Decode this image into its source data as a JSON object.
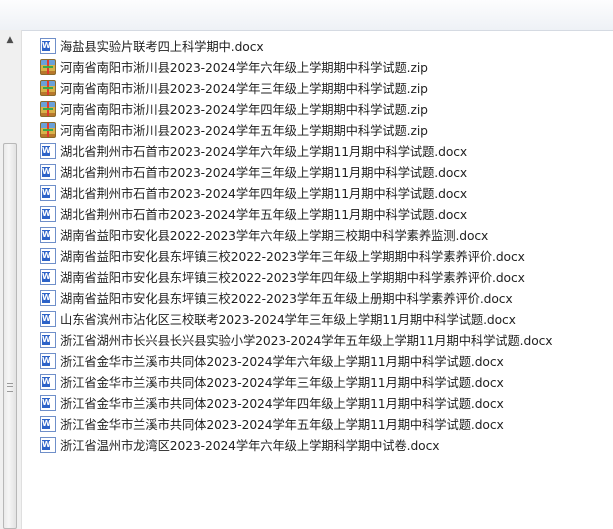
{
  "files": [
    {
      "name": "海盐县实验片联考四上科学期中.docx",
      "icon": "word-doc-icon"
    },
    {
      "name": "河南省南阳市淅川县2023-2024学年六年级上学期期中科学试题.zip",
      "icon": "zip-archive-icon"
    },
    {
      "name": "河南省南阳市淅川县2023-2024学年三年级上学期期中科学试题.zip",
      "icon": "zip-archive-icon"
    },
    {
      "name": "河南省南阳市淅川县2023-2024学年四年级上学期期中科学试题.zip",
      "icon": "zip-archive-icon"
    },
    {
      "name": "河南省南阳市淅川县2023-2024学年五年级上学期期中科学试题.zip",
      "icon": "zip-archive-icon"
    },
    {
      "name": "湖北省荆州市石首市2023-2024学年六年级上学期11月期中科学试题.docx",
      "icon": "word-doc-icon"
    },
    {
      "name": "湖北省荆州市石首市2023-2024学年三年级上学期11月期中科学试题.docx",
      "icon": "word-doc-icon"
    },
    {
      "name": "湖北省荆州市石首市2023-2024学年四年级上学期11月期中科学试题.docx",
      "icon": "word-doc-icon"
    },
    {
      "name": "湖北省荆州市石首市2023-2024学年五年级上学期11月期中科学试题.docx",
      "icon": "word-doc-icon"
    },
    {
      "name": "湖南省益阳市安化县2022-2023学年六年级上学期三校期中科学素养监测.docx",
      "icon": "word-doc-icon"
    },
    {
      "name": "湖南省益阳市安化县东坪镇三校2022-2023学年三年级上学期期中科学素养评价.docx",
      "icon": "word-doc-icon"
    },
    {
      "name": "湖南省益阳市安化县东坪镇三校2022-2023学年四年级上学期期中科学素养评价.docx",
      "icon": "word-doc-icon"
    },
    {
      "name": "湖南省益阳市安化县东坪镇三校2022-2023学年五年级上册期中科学素养评价.docx",
      "icon": "word-doc-icon"
    },
    {
      "name": "山东省滨州市沾化区三校联考2023-2024学年三年级上学期11月期中科学试题.docx",
      "icon": "word-doc-icon"
    },
    {
      "name": "浙江省湖州市长兴县长兴县实验小学2023-2024学年五年级上学期11月期中科学试题.docx",
      "icon": "word-doc-icon"
    },
    {
      "name": "浙江省金华市兰溪市共同体2023-2024学年六年级上学期11月期中科学试题.docx",
      "icon": "word-doc-icon"
    },
    {
      "name": "浙江省金华市兰溪市共同体2023-2024学年三年级上学期11月期中科学试题.docx",
      "icon": "word-doc-icon"
    },
    {
      "name": "浙江省金华市兰溪市共同体2023-2024学年四年级上学期11月期中科学试题.docx",
      "icon": "word-doc-icon"
    },
    {
      "name": "浙江省金华市兰溪市共同体2023-2024学年五年级上学期11月期中科学试题.docx",
      "icon": "word-doc-icon"
    },
    {
      "name": "浙江省温州市龙湾区2023-2024学年六年级上学期科学期中试卷.docx",
      "icon": "word-doc-icon"
    }
  ]
}
